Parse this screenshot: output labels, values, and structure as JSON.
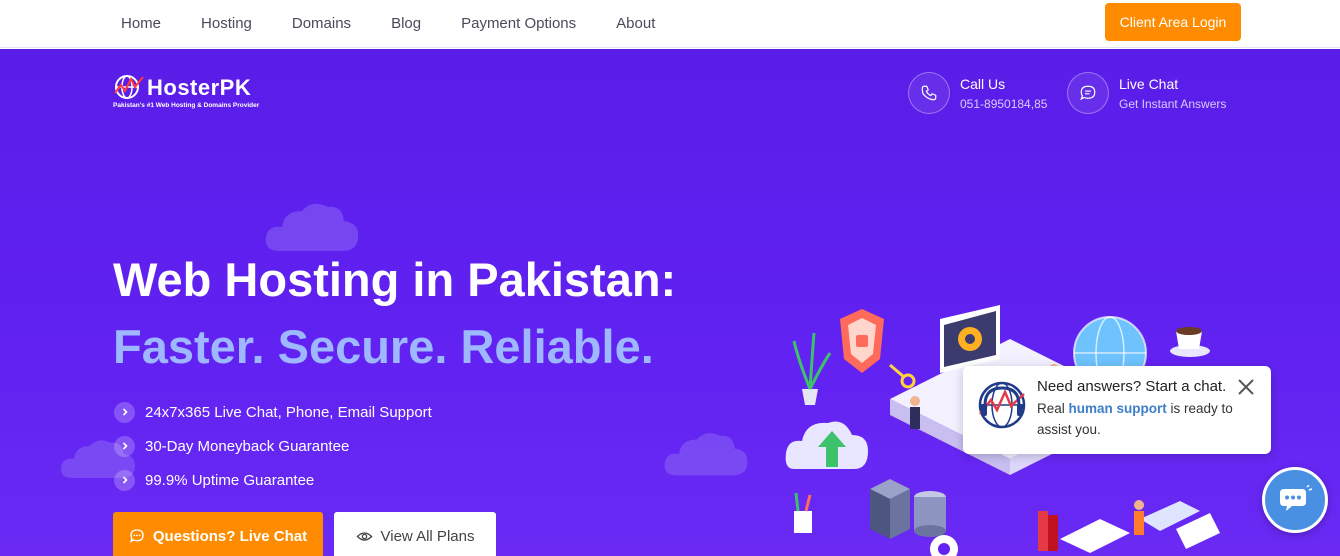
{
  "nav": {
    "items": [
      {
        "label": "Home"
      },
      {
        "label": "Hosting"
      },
      {
        "label": "Domains"
      },
      {
        "label": "Blog"
      },
      {
        "label": "Payment Options"
      },
      {
        "label": "About"
      }
    ],
    "client_login": "Client Area Login"
  },
  "brand": {
    "name": "HosterPK",
    "tagline": "Pakistan's #1 Web Hosting & Domains Provider"
  },
  "contacts": [
    {
      "icon": "phone-icon",
      "title": "Call Us",
      "subtitle": "051-8950184,85"
    },
    {
      "icon": "chat-bubble-icon",
      "title": "Live Chat",
      "subtitle": "Get Instant Answers"
    }
  ],
  "hero": {
    "headline": "Web Hosting in Pakistan:",
    "subheadline": "Faster. Secure. Reliable.",
    "features": [
      "24x7x365 Live Chat, Phone, Email Support",
      "30-Day Moneyback Guarantee",
      "99.9% Uptime Guarantee"
    ],
    "cta_chat": "Questions? Live Chat",
    "cta_plans": "View All Plans"
  },
  "chat_widget": {
    "title": "Need answers? Start a chat.",
    "text_before": "Real ",
    "highlight": "human support",
    "text_after": " is ready to assist you."
  },
  "colors": {
    "hero_bg": "#5f20f0",
    "accent_orange": "#ff8c00",
    "subhead_blue": "#9db8ff",
    "chat_blue": "#4a90e2"
  }
}
